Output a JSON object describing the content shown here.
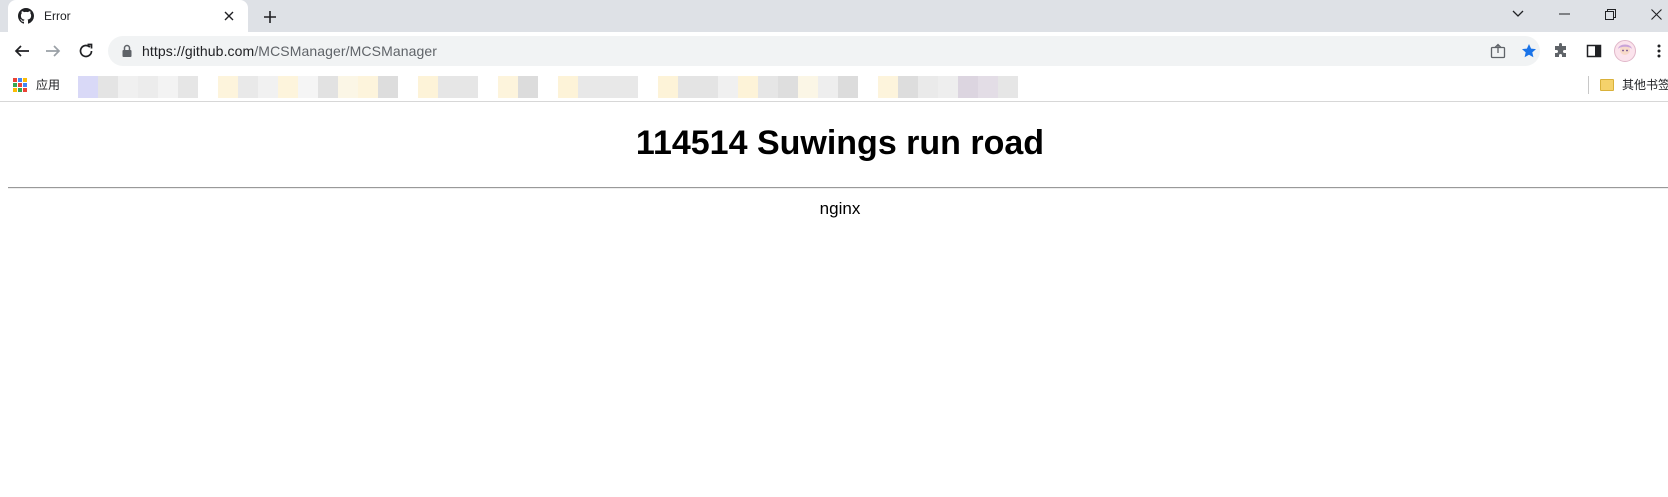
{
  "tab": {
    "title": "Error",
    "favicon": "github-icon"
  },
  "toolbar": {
    "url_host": "https://github.com",
    "url_path": "/MCSManager/MCSManager",
    "bookmark_star_color": "#1a73e8"
  },
  "bookmarks": {
    "apps_label": "应用",
    "other_label": "其他书签"
  },
  "page": {
    "heading": "114514 Suwings run road",
    "server": "nginx"
  }
}
